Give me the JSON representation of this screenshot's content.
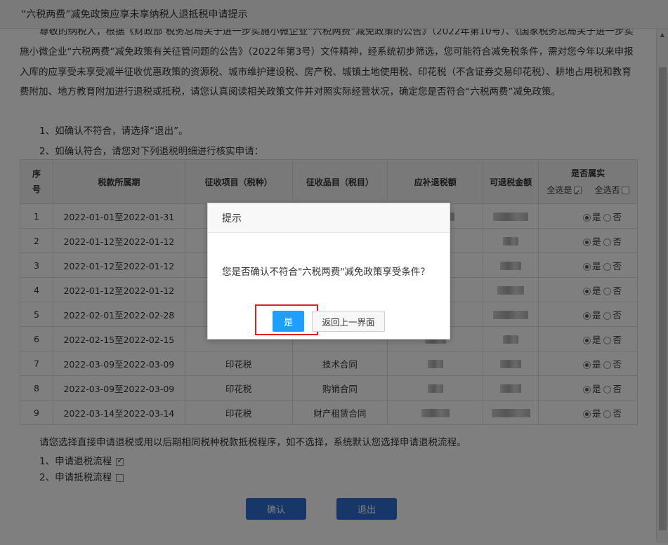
{
  "window": {
    "title": "“六税两费”减免政策应享未享纳税人退抵税申请提示"
  },
  "intro": {
    "paragraph": "尊敬的纳税人，根据《财政部 税务总局关于进一步实施小微企业“六税两费”减免政策的公告》（2022年第10号）、《国家税务总局关于进一步实施小微企业“六税两费”减免政策有关征管问题的公告》（2022年第3号）文件精神，经系统初步筛选，您可能符合减免税条件，需对您今年以来申报入库的应享受未享受减半征收优惠政策的资源税、城市维护建设税、房产税、城镇土地使用税、印花税（不含证券交易印花税）、耕地占用税和教育费附加、地方教育附加进行退税或抵税，请您认真阅读相关政策文件并对照实际经营状况，确定您是否符合“六税两费”减免政策。",
    "rule1": "1、如确认不符合，请选择“退出”。",
    "rule2": "2、如确认符合，请您对下列退税明细进行核实申请："
  },
  "table": {
    "headers": {
      "seq": "序号",
      "period": "税款所属期",
      "item": "征收项目（税种）",
      "subitem": "征收品目（税目）",
      "supplement": "应补退税额",
      "refundable": "可退税金额",
      "belong": "是否属实",
      "select_all_yes": "全选是",
      "select_all_no": "全选否"
    },
    "yes_label": "是",
    "no_label": "否",
    "rows": [
      {
        "seq": "1",
        "period": "2022-01-01至2022-01-31",
        "item": "",
        "subitem": ""
      },
      {
        "seq": "2",
        "period": "2022-01-12至2022-01-12",
        "item": "",
        "subitem": ""
      },
      {
        "seq": "3",
        "period": "2022-01-12至2022-01-12",
        "item": "",
        "subitem": ""
      },
      {
        "seq": "4",
        "period": "2022-01-12至2022-01-12",
        "item": "",
        "subitem": ""
      },
      {
        "seq": "5",
        "period": "2022-02-01至2022-02-28",
        "item": "",
        "subitem": ""
      },
      {
        "seq": "6",
        "period": "2022-02-15至2022-02-15",
        "item": "",
        "subitem": ""
      },
      {
        "seq": "7",
        "period": "2022-03-09至2022-03-09",
        "item": "印花税",
        "subitem": "技术合同"
      },
      {
        "seq": "8",
        "period": "2022-03-09至2022-03-09",
        "item": "印花税",
        "subitem": "购销合同"
      },
      {
        "seq": "9",
        "period": "2022-03-14至2022-03-14",
        "item": "印花税",
        "subitem": "财产租赁合同"
      }
    ]
  },
  "footer": {
    "choose_text": "请您选择直接申请退税或用以后期相同税种税款抵税程序，如不选择，系统默认您选择申请退税流程。",
    "option1": "1、申请退税流程",
    "option2": "2、申请抵税流程",
    "confirm": "确认",
    "exit": "退出"
  },
  "dialog": {
    "title": "提示",
    "message": "您是否确认不符合\"六税两费\"减免政策享受条件？",
    "yes": "是",
    "back": "返回上一界面"
  }
}
